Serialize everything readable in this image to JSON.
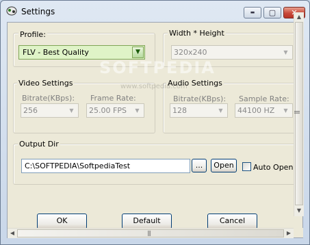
{
  "window": {
    "title": "Settings",
    "controls": {
      "minimize": "▬",
      "maximize": "▢",
      "close": "✕"
    }
  },
  "profile": {
    "label": "Profile:",
    "value": "FLV - Best Quality",
    "arrow": "▼"
  },
  "size": {
    "label": "Width * Height",
    "value": "320x240",
    "arrow": "▼"
  },
  "video": {
    "group_label": "Video Settings",
    "bitrate": {
      "label": "Bitrate(KBps):",
      "value": "256",
      "arrow": "▼"
    },
    "framerate": {
      "label": "Frame Rate:",
      "value": "25.00 FPS",
      "arrow": "▼"
    }
  },
  "audio": {
    "group_label": "Audio Settings",
    "bitrate": {
      "label": "Bitrate(KBps):",
      "value": "128",
      "arrow": "▼"
    },
    "samplerate": {
      "label": "Sample Rate:",
      "value": "44100 HZ",
      "arrow": "▼"
    }
  },
  "output": {
    "label": "Output Dir",
    "path": "C:\\SOFTPEDIA\\SoftpediaTest",
    "browse_label": "...",
    "open_label": "Open",
    "auto_open_label": "Auto Open",
    "auto_open_checked": false
  },
  "buttons": {
    "ok": "OK",
    "default": "Default",
    "cancel": "Cancel"
  },
  "watermark": {
    "main": "SOFTPEDIA",
    "url": "www.softpedia.com"
  },
  "scrollbars": {
    "up": "▲",
    "down": "▼",
    "left": "◀",
    "right": "▶",
    "grip": "|||"
  },
  "colors": {
    "accent_green": "#7fa556",
    "title_bar": "#c9d7e9",
    "close_red": "#c8493a"
  },
  "icons": {
    "app": "settings-app-icon"
  }
}
